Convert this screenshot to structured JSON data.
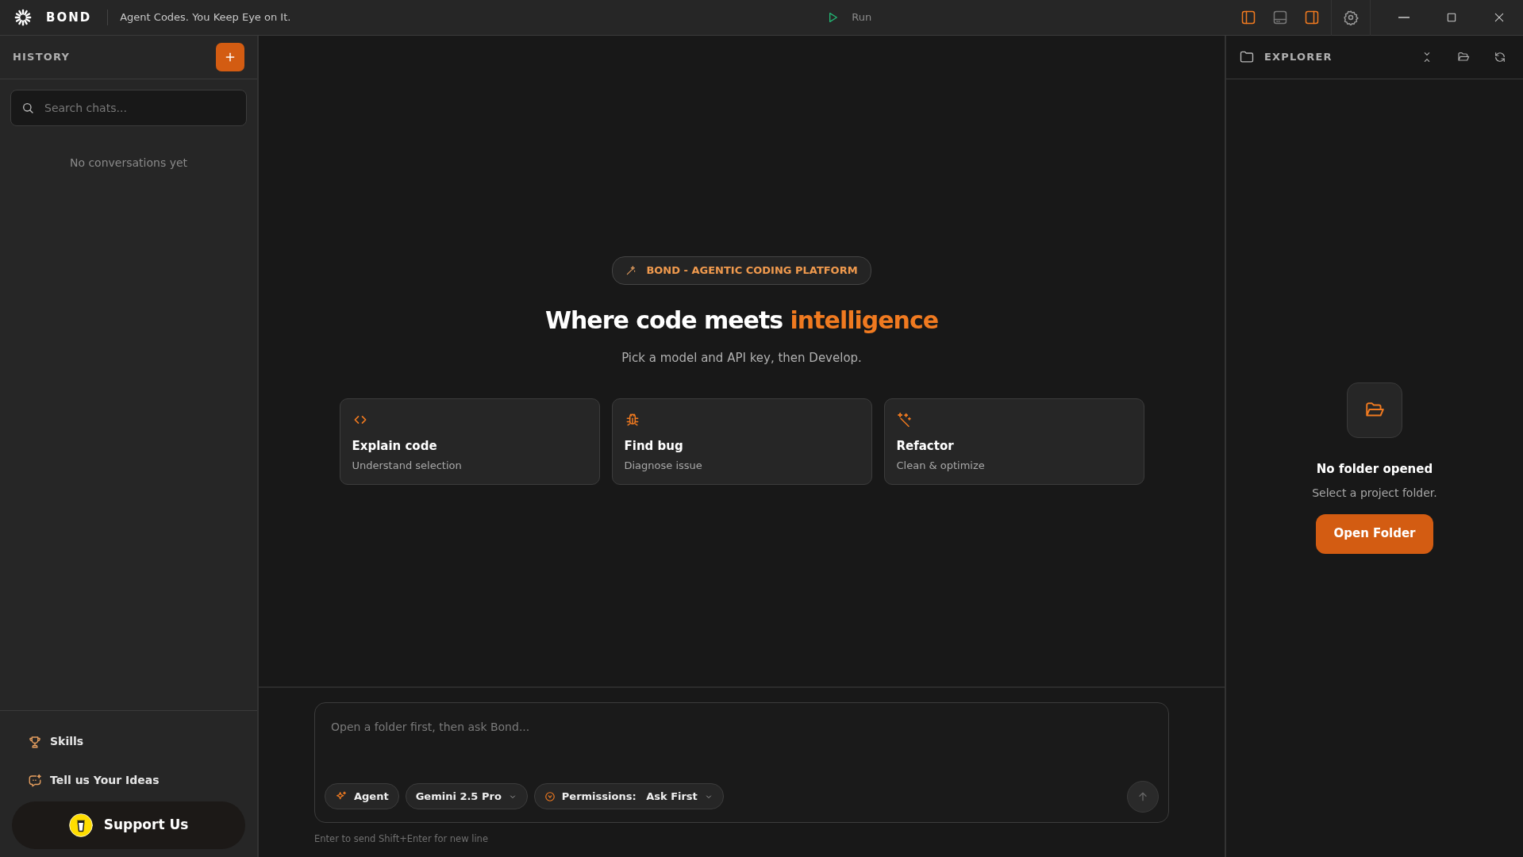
{
  "titlebar": {
    "app_name": "BOND",
    "tagline": "Agent Codes. You Keep Eye on It.",
    "run_label": "Run",
    "panel_toggles": [
      {
        "kind": "left",
        "on": true
      },
      {
        "kind": "bottom",
        "on": false
      },
      {
        "kind": "right",
        "on": true
      }
    ]
  },
  "sidebar": {
    "title": "HISTORY",
    "search": {
      "placeholder": "Search chats..."
    },
    "empty_text": "No conversations yet",
    "footer_links": [
      {
        "kind": "trophy",
        "label": "Skills"
      },
      {
        "kind": "ideas",
        "label": "Tell us Your Ideas"
      }
    ],
    "support_button": "Support Us"
  },
  "main": {
    "badge": "BOND - AGENTIC CODING PLATFORM",
    "heading": "Where code meets **intelligence**",
    "subheading": "Pick a model and API key, then Develop.",
    "cards": [
      {
        "kind": "code",
        "title": "Explain code",
        "subtitle": "Understand selection"
      },
      {
        "kind": "bug",
        "title": "Find bug",
        "subtitle": "Diagnose issue"
      },
      {
        "kind": "wand",
        "title": "Refactor",
        "subtitle": "Clean & optimize"
      }
    ],
    "composer": {
      "placeholder": "Open a folder first, then ask Bond...",
      "mode": "Agent",
      "model": "Gemini 2.5 Pro",
      "permissions_label": "Permissions:",
      "permissions_value": "Ask First",
      "hint": "Enter to send Shift+Enter for new line"
    }
  },
  "explorer": {
    "title": "EXPLORER",
    "empty_title": "No folder opened",
    "empty_text": "Select a project folder.",
    "button": "Open Folder"
  }
}
